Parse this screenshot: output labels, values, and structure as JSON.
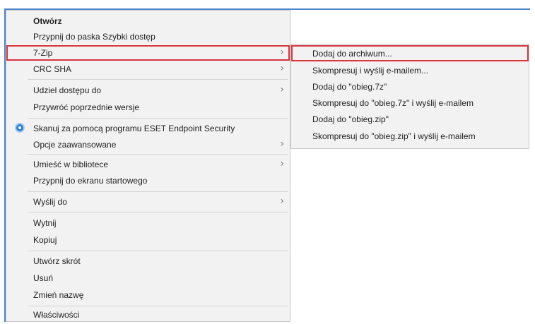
{
  "context_menu": {
    "items": [
      {
        "label": "Otwórz"
      },
      {
        "label": "Przypnij do paska Szybki dostęp"
      },
      {
        "label": "7-Zip"
      },
      {
        "label": "CRC SHA"
      },
      {
        "label": "Udziel dostępu do"
      },
      {
        "label": "Przywróć poprzednie wersje"
      },
      {
        "label": "Skanuj za pomocą programu ESET Endpoint Security",
        "icon": "eset-shield-icon"
      },
      {
        "label": "Opcje zaawansowane"
      },
      {
        "label": "Umieść w bibliotece"
      },
      {
        "label": "Przypnij do ekranu startowego"
      },
      {
        "label": "Wyślij do"
      },
      {
        "label": "Wytnij"
      },
      {
        "label": "Kopiuj"
      },
      {
        "label": "Utwórz skrót"
      },
      {
        "label": "Usuń"
      },
      {
        "label": "Zmień nazwę"
      },
      {
        "label": "Właściwości"
      }
    ]
  },
  "submenu_7zip": {
    "items": [
      {
        "label": "Dodaj do archiwum..."
      },
      {
        "label": "Skompresuj i wyślij e-mailem..."
      },
      {
        "label": "Dodaj do \"obieg.7z\""
      },
      {
        "label": "Skompresuj do \"obieg.7z\" i wyślij e-mailem"
      },
      {
        "label": "Dodaj do \"obieg.zip\""
      },
      {
        "label": "Skompresuj do \"obieg.zip\" i wyślij e-mailem"
      }
    ]
  },
  "icons": {
    "submenu_arrow": "chevron-right-icon"
  },
  "colors": {
    "highlight_border": "#d9363e",
    "menu_background": "#f2f2f2",
    "window_border": "#4a86c8"
  }
}
